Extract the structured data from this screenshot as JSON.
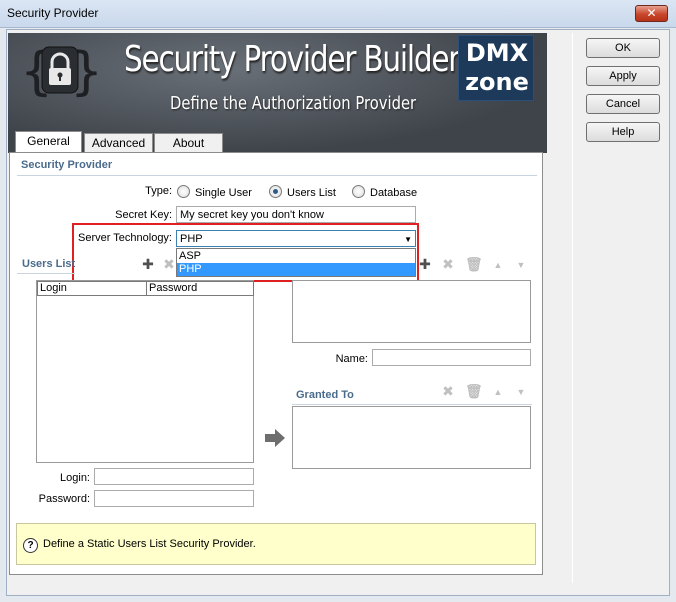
{
  "window": {
    "title": "Security Provider",
    "close_label": "✕"
  },
  "dialog_buttons": {
    "ok": "OK",
    "apply": "Apply",
    "cancel": "Cancel",
    "help": "Help"
  },
  "banner": {
    "title": "Security Provider Builder",
    "subtitle": "Define the Authorization Provider",
    "logo_top": "DMX",
    "logo_bottom": "zone"
  },
  "tabs": [
    {
      "label": "General",
      "active": true
    },
    {
      "label": "Advanced"
    },
    {
      "label": "About"
    }
  ],
  "security_provider": {
    "section_title": "Security Provider",
    "type_label": "Type:",
    "type_options": [
      "Single User",
      "Users List",
      "Database"
    ],
    "type_selected": "Users List",
    "secret_key_label": "Secret Key:",
    "secret_key_value": "My secret key you don't know",
    "server_tech_label": "Server Technology:",
    "server_tech_value": "PHP",
    "server_tech_options": [
      "ASP",
      "PHP"
    ],
    "server_tech_highlighted": "PHP"
  },
  "users_list": {
    "section_title": "Users List",
    "columns": [
      "Login",
      "Password"
    ],
    "login_label": "Login:",
    "password_label": "Password:",
    "login_value": "",
    "password_value": ""
  },
  "permissions": {
    "name_label": "Name:",
    "name_value": ""
  },
  "granted_to": {
    "section_title": "Granted To"
  },
  "icons": {
    "add": "plus-icon",
    "delete": "x-icon",
    "trash": "trash-icon",
    "up": "arrow-up-icon",
    "down": "arrow-down-icon",
    "grant": "arrow-right-icon",
    "help": "question-icon"
  },
  "info": {
    "text": "Define a Static Users List Security Provider."
  },
  "colors": {
    "accent": "#3399ff",
    "highlight_border": "#e02020",
    "section_title": "#4b6b8c",
    "info_bg": "#ffffcc"
  }
}
